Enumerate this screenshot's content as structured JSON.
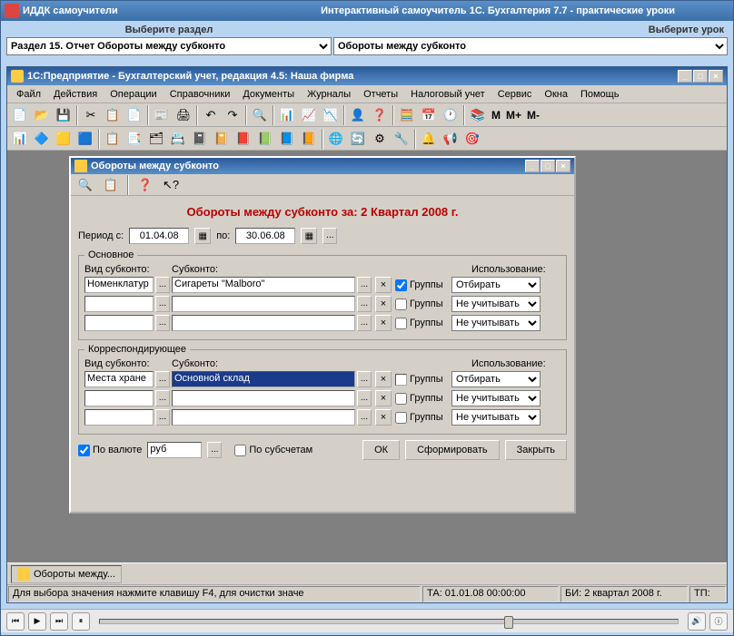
{
  "outer": {
    "app_title": "ИДДК самоучители",
    "subtitle": "Интерактивный самоучитель 1С. Бухгалтерия 7.7 - практические уроки",
    "select_section": "Выберите раздел",
    "select_lesson": "Выберите урок",
    "section_value": "Раздел 15. Отчет Обороты между субконто",
    "lesson_value": "Обороты между субконто"
  },
  "inner": {
    "title": "1С:Предприятие - Бухгалтерский учет, редакция 4.5: Наша фирма",
    "menus": [
      "Файл",
      "Действия",
      "Операции",
      "Справочники",
      "Документы",
      "Журналы",
      "Отчеты",
      "Налоговый учет",
      "Сервис",
      "Окна",
      "Помощь"
    ],
    "m_labels": [
      "М",
      "М+",
      "М-"
    ]
  },
  "dialog": {
    "title": "Обороты между субконто",
    "report_title": "Обороты между субконто за: 2 Квартал 2008 г.",
    "period_from_lbl": "Период с:",
    "period_from": "01.04.08",
    "period_to_lbl": "по:",
    "period_to": "30.06.08",
    "main_legend": "Основное",
    "corr_legend": "Корреспондирующее",
    "hdr_kind": "Вид субконто:",
    "hdr_sub": "Субконто:",
    "hdr_use": "Использование:",
    "groups_lbl": "Группы",
    "main_rows": [
      {
        "kind": "Номенклатур",
        "sub": "Сигареты \"Malboro\"",
        "grp": true,
        "use": "Отбирать"
      },
      {
        "kind": "",
        "sub": "",
        "grp": false,
        "use": "Не учитывать"
      },
      {
        "kind": "",
        "sub": "",
        "grp": false,
        "use": "Не учитывать"
      }
    ],
    "corr_rows": [
      {
        "kind": "Места хране",
        "sub": "Основной склад",
        "grp": true,
        "use": "Отбирать",
        "highlight": true
      },
      {
        "kind": "",
        "sub": "",
        "grp": false,
        "use": "Не учитывать"
      },
      {
        "kind": "",
        "sub": "",
        "grp": false,
        "use": "Не учитывать"
      }
    ],
    "by_currency": "По валюте",
    "currency": "руб",
    "by_subacc": "По субсчетам",
    "ok": "ОК",
    "form": "Сформировать",
    "close": "Закрыть"
  },
  "task": {
    "label": "Обороты между..."
  },
  "status": {
    "hint": "Для выбора значения нажмите клавишу F4, для очистки значе",
    "ta": "ТА: 01.01.08 00:00:00",
    "bi": "БИ: 2 квартал 2008 г.",
    "tp": "ТП:"
  }
}
